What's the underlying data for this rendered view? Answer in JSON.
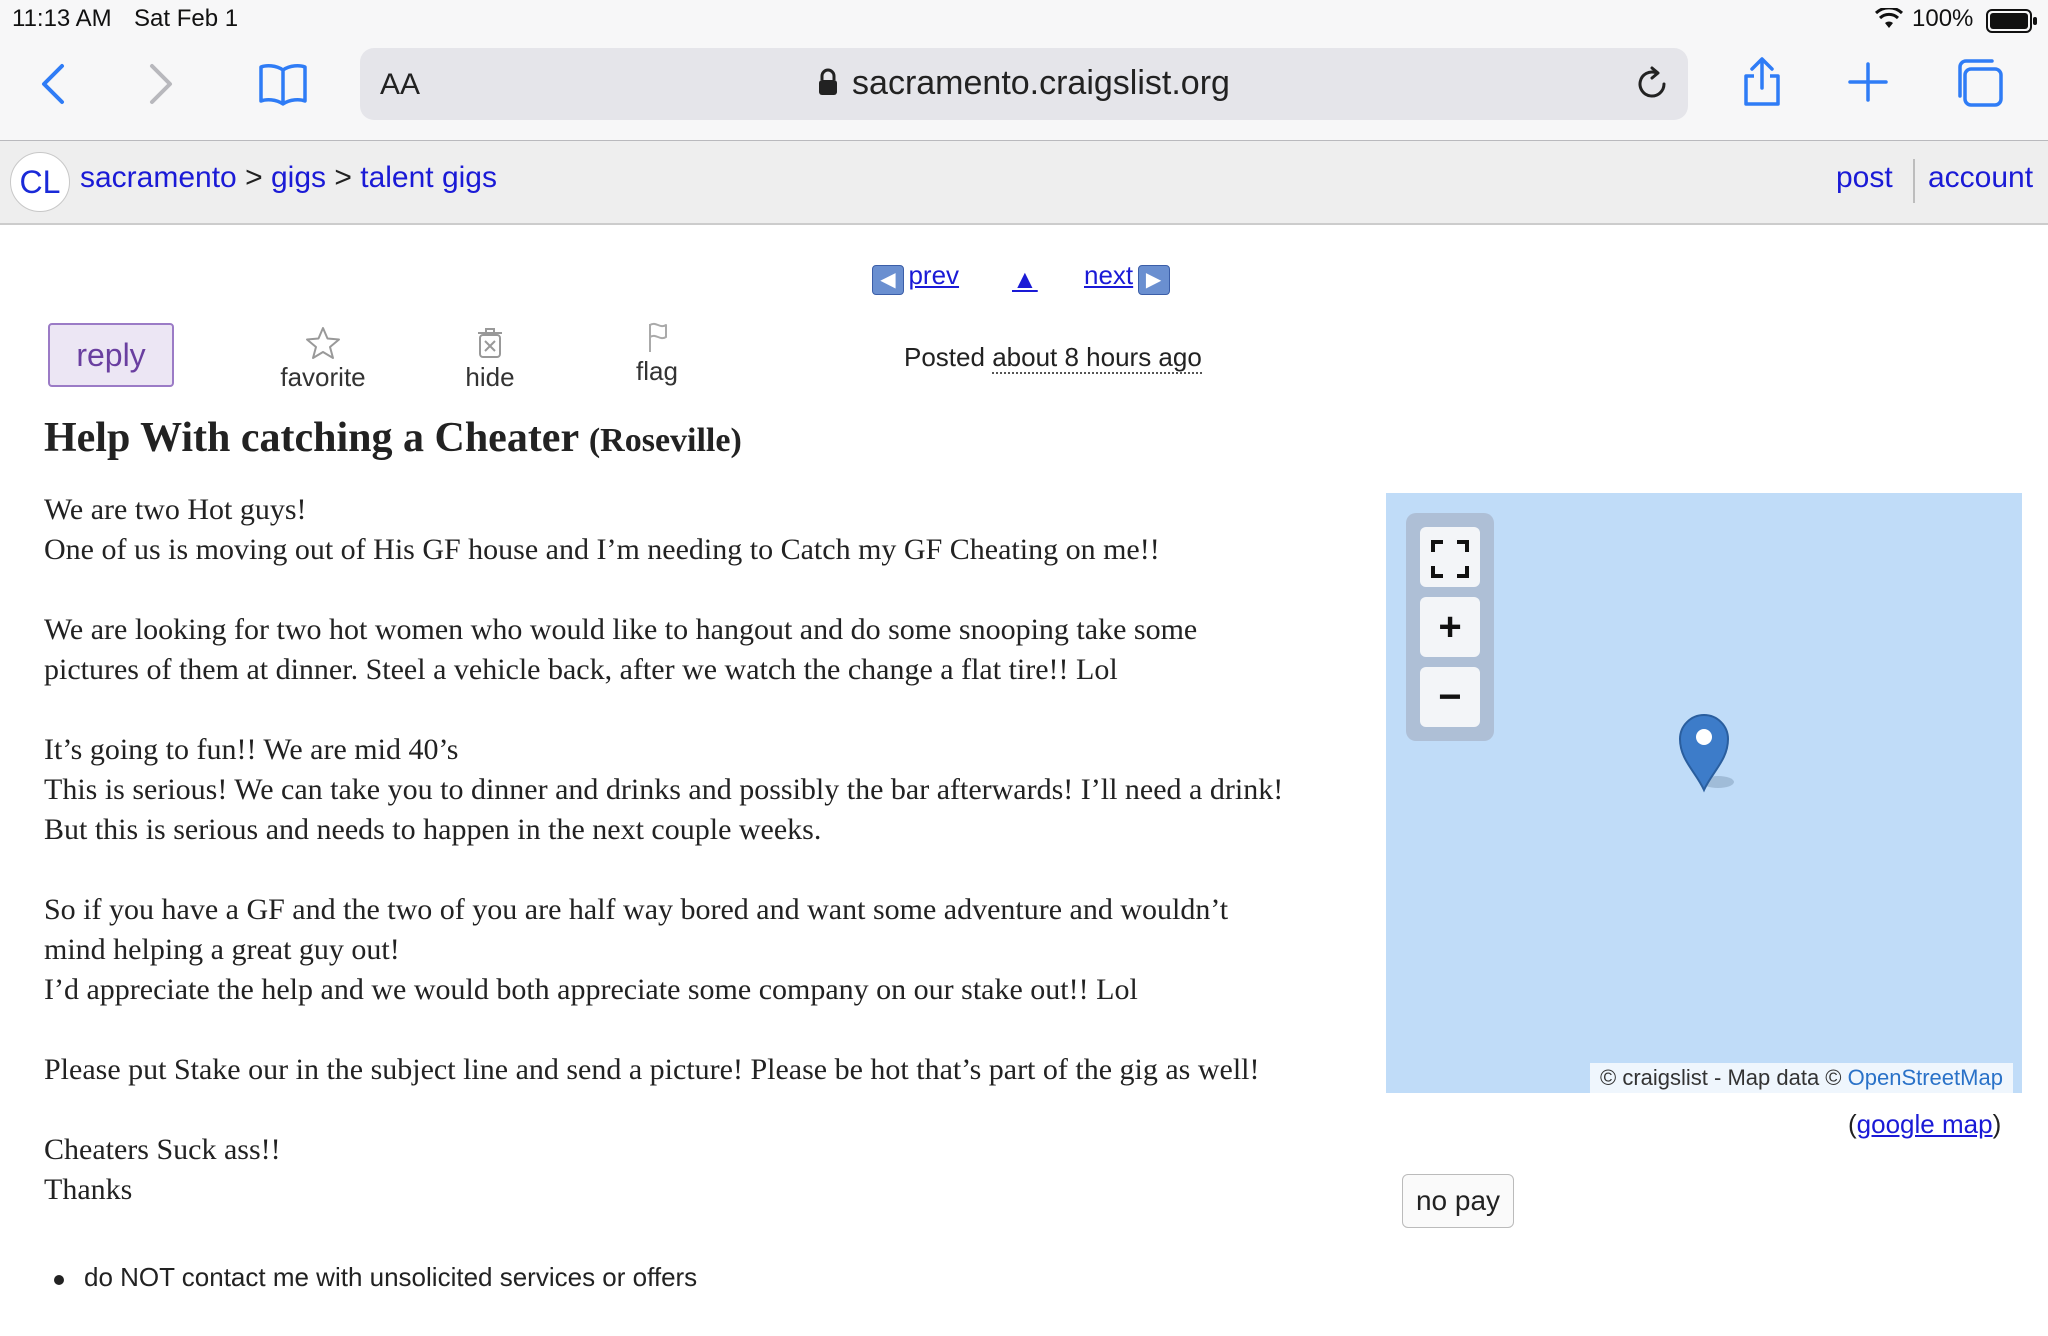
{
  "status_bar": {
    "time": "11:13 AM",
    "date": "Sat Feb 1",
    "battery": "100%"
  },
  "browser": {
    "aa_label": "AA",
    "url": "sacramento.craigslist.org"
  },
  "header": {
    "logo": "CL",
    "breadcrumbs": [
      "sacramento",
      "gigs",
      "talent gigs"
    ],
    "separator": ">",
    "post_label": "post",
    "account_label": "account"
  },
  "nav": {
    "prev_label": "prev",
    "up_label": "▲",
    "next_label": "next"
  },
  "actions": {
    "reply_label": "reply",
    "favorite_label": "favorite",
    "hide_label": "hide",
    "flag_label": "flag"
  },
  "posted": {
    "prefix": "Posted",
    "ago": "about 8 hours ago"
  },
  "posting": {
    "title": "Help With catching a Cheater",
    "location": "(Roseville)",
    "paragraphs": [
      [
        "We are two Hot guys!",
        "One of us is moving out of His GF house and I’m needing to Catch my GF Cheating on me!!"
      ],
      [
        "We are looking for two hot women who would like to hangout and do some snooping take some",
        "pictures of them at dinner. Steel a vehicle back, after we watch the change a flat tire!! Lol"
      ],
      [
        "It’s going to fun!! We are mid 40’s",
        "This is serious! We can take you to dinner and drinks and possibly the bar afterwards! I’ll need a drink!",
        "But this is serious and needs to happen in the next couple weeks."
      ],
      [
        "So if you have a GF and the two of you are half way bored and want some adventure and wouldn’t",
        "mind helping a great guy out!",
        "I’d appreciate the help and we would both appreciate some company on our stake out!! Lol"
      ],
      [
        "Please put Stake our in the subject line and send a picture! Please be hot that’s part of the gig as well!"
      ],
      [
        "Cheaters Suck ass!!",
        "Thanks"
      ]
    ],
    "notice": "do NOT contact me with unsolicited services or offers"
  },
  "map": {
    "attribution_prefix": "© craigslist - Map data ©",
    "attribution_link": "OpenStreetMap",
    "zoom_in": "+",
    "zoom_out": "−",
    "google_open": "(",
    "google_link": "google map",
    "google_close": ")",
    "water_color": "#c0dcf8",
    "marker_color": "#3d7cc9"
  },
  "compensation": "no pay"
}
